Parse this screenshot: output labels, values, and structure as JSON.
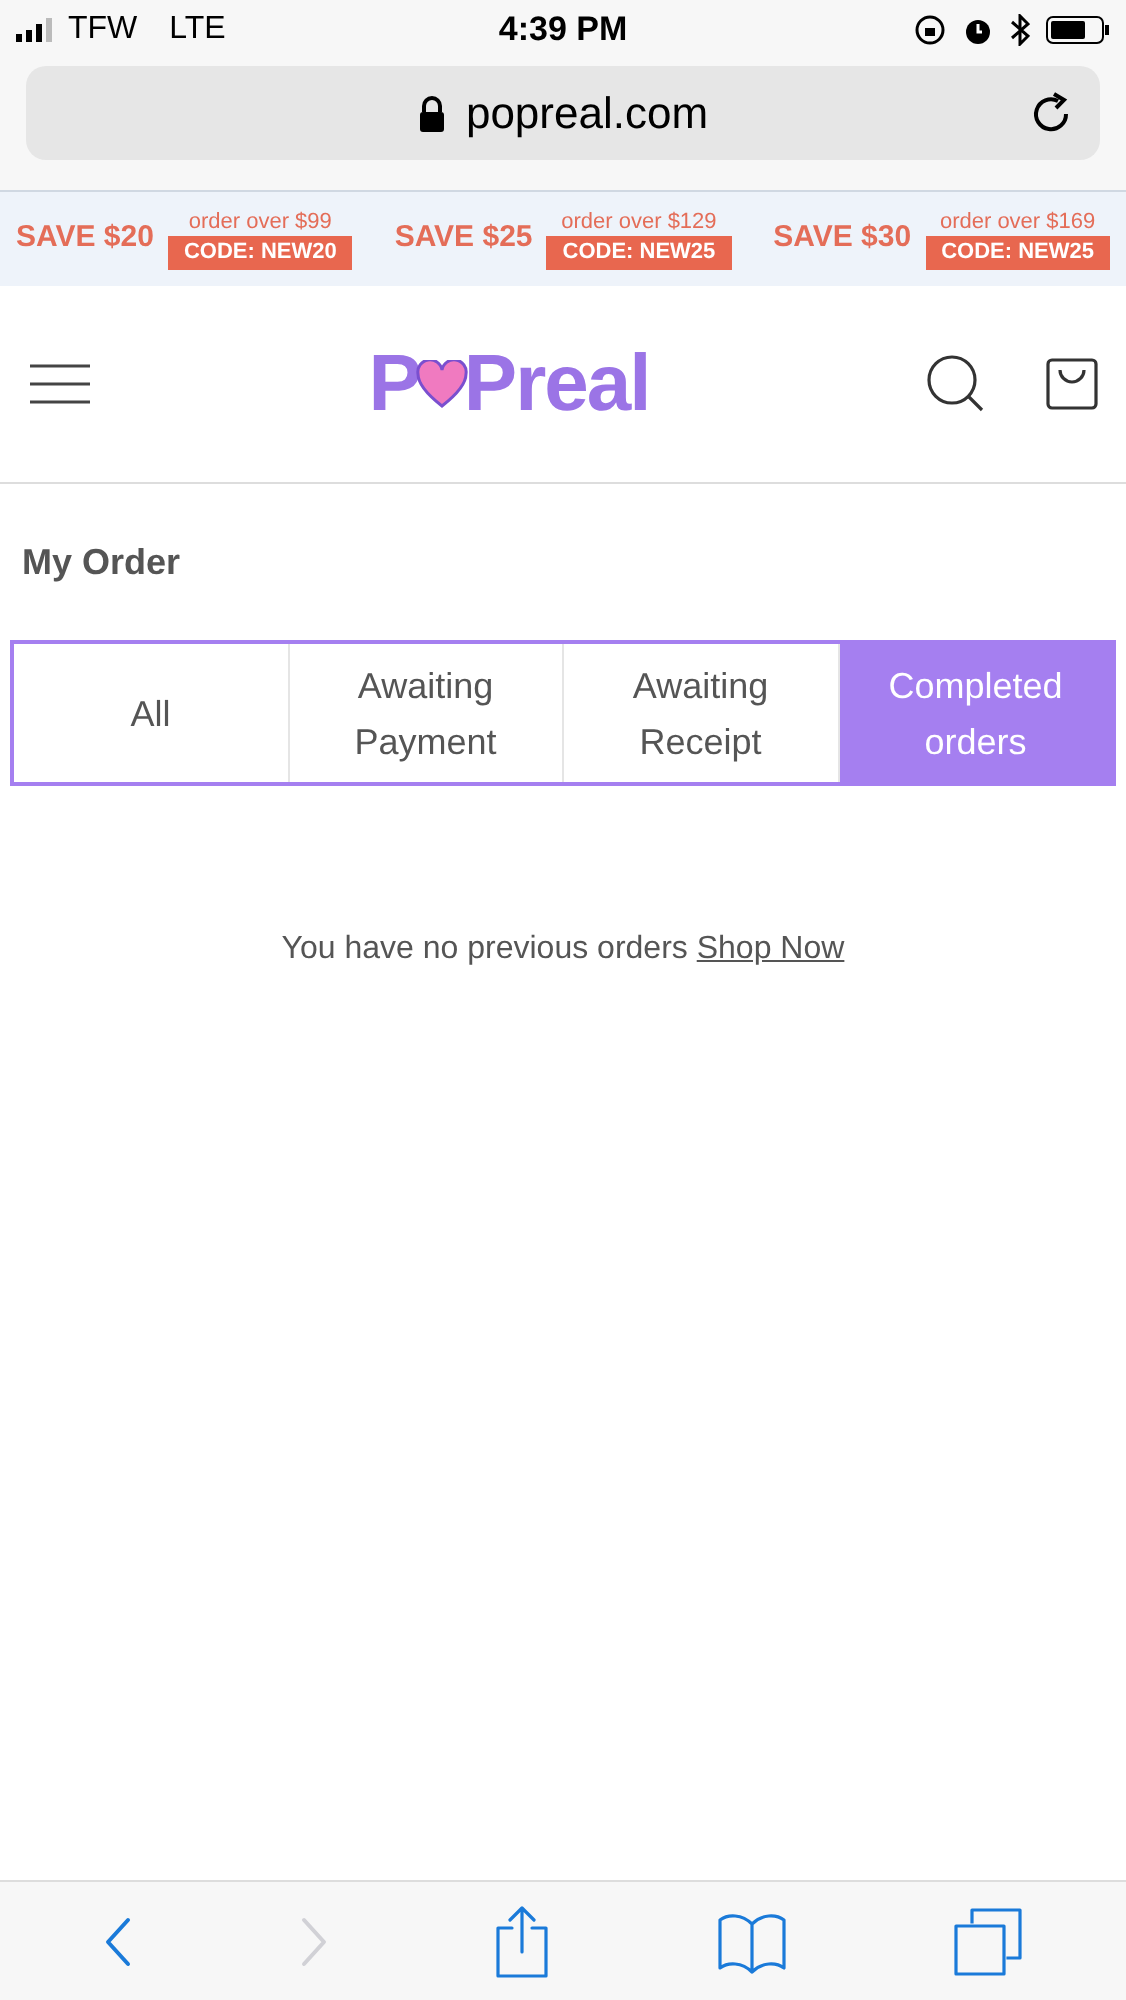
{
  "status_bar": {
    "carrier": "TFW",
    "network": "LTE",
    "time": "4:39 PM"
  },
  "address_bar": {
    "url": "popreal.com"
  },
  "promo_banner": [
    {
      "save": "SAVE $20",
      "condition": "order over $99",
      "code": "CODE: NEW20"
    },
    {
      "save": "SAVE $25",
      "condition": "order over $129",
      "code": "CODE: NEW25"
    },
    {
      "save": "SAVE $30",
      "condition": "order over $169",
      "code": "CODE: NEW25"
    }
  ],
  "header": {
    "logo_start": "P",
    "logo_end": "Preal"
  },
  "page_title": "My Order",
  "tabs": [
    {
      "lines": [
        "All"
      ],
      "selected": false
    },
    {
      "lines": [
        "Awaiting",
        "Payment"
      ],
      "selected": false
    },
    {
      "lines": [
        "Awaiting",
        "Receipt"
      ],
      "selected": false
    },
    {
      "lines": [
        "Completed",
        "orders"
      ],
      "selected": true
    }
  ],
  "empty_message": {
    "text": "You have no previous orders",
    "link": "Shop Now"
  },
  "toolbar": [
    {
      "kind": "back",
      "disabled": false
    },
    {
      "kind": "forward",
      "disabled": true
    },
    {
      "kind": "share",
      "disabled": false
    },
    {
      "kind": "bookmarks",
      "disabled": false
    },
    {
      "kind": "tabs",
      "disabled": false
    }
  ]
}
